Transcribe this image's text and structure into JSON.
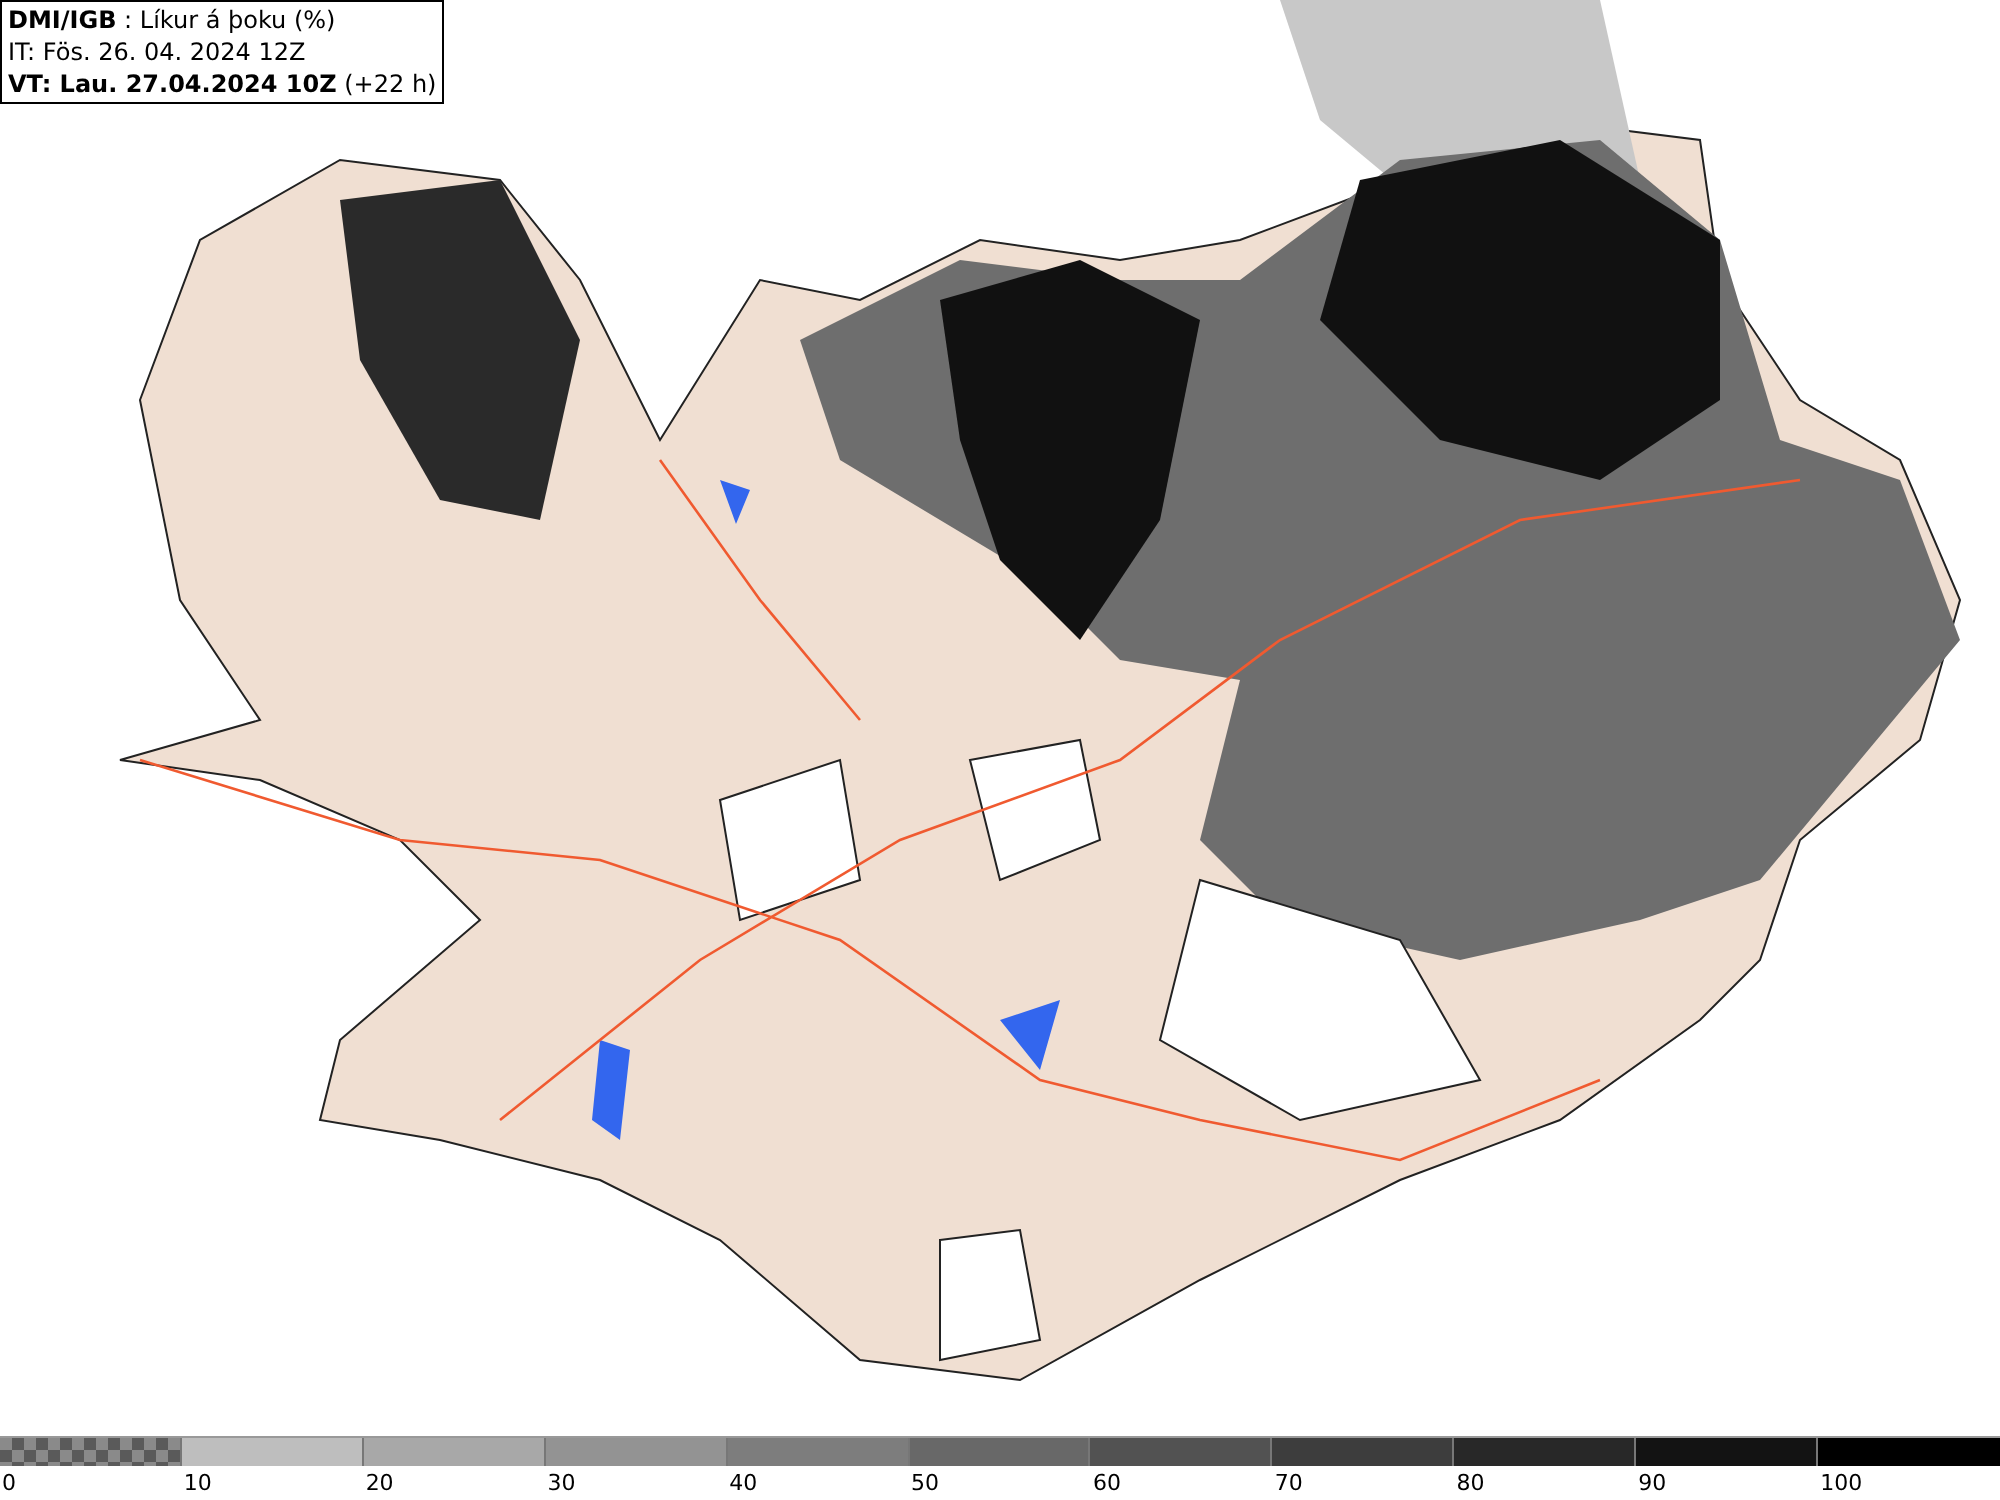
{
  "header": {
    "lines": [
      "**DMI/IGB** : Líkur á þoku (%)",
      "IT: Fös. 26. 04. 2024 12Z",
      "**VT: Lau. 27.04.2024 10Z** (+22 h)"
    ]
  },
  "legend": {
    "segments": [
      {
        "kind": "checker",
        "color": "#5a5a5a"
      },
      {
        "kind": "solid",
        "color": "#bebebe"
      },
      {
        "kind": "solid",
        "color": "#a8a8a8"
      },
      {
        "kind": "solid",
        "color": "#939393"
      },
      {
        "kind": "solid",
        "color": "#7d7d7d"
      },
      {
        "kind": "solid",
        "color": "#686868"
      },
      {
        "kind": "solid",
        "color": "#525252"
      },
      {
        "kind": "solid",
        "color": "#3d3d3d"
      },
      {
        "kind": "solid",
        "color": "#282828"
      },
      {
        "kind": "solid",
        "color": "#131313"
      },
      {
        "kind": "solid",
        "color": "#000000"
      }
    ],
    "labels": [
      "0",
      "10",
      "20",
      "30",
      "40",
      "50",
      "60",
      "70",
      "80",
      "90",
      "100"
    ]
  }
}
